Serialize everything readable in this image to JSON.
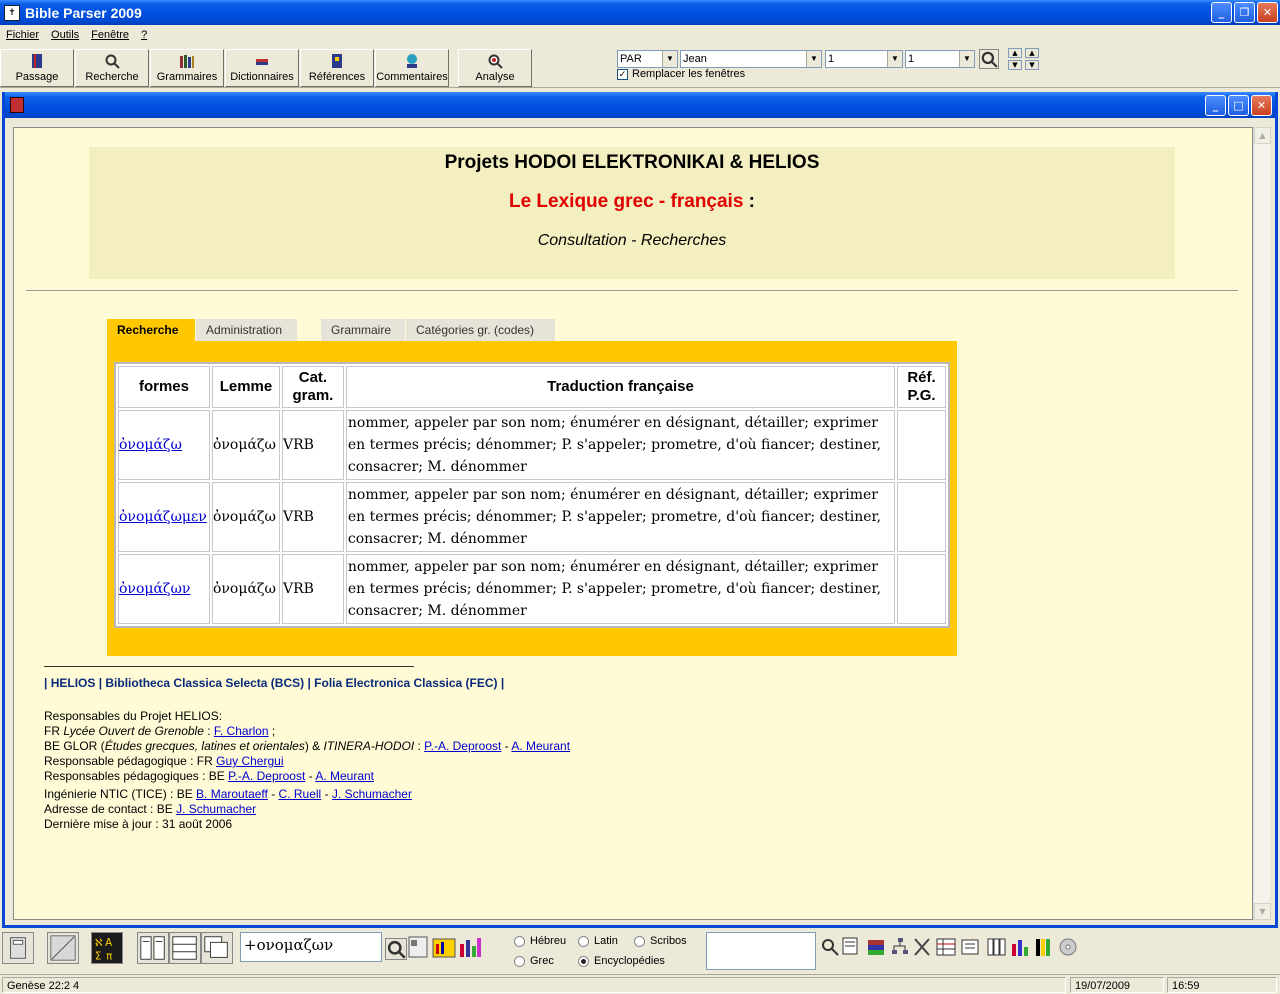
{
  "window": {
    "title": "Bible Parser 2009"
  },
  "menu": [
    "Fichier",
    "Outils",
    "Fenêtre",
    "?"
  ],
  "toolbar": {
    "buttons": [
      "Passage",
      "Recherche",
      "Grammaires",
      "Dictionnaires",
      "Références",
      "Commentaires",
      "Analyse"
    ],
    "version": "PAR",
    "book": "Jean",
    "chapter": "1",
    "verse": "1",
    "replace_windows_label": "Remplacer les fenêtres",
    "replace_windows_checked": true
  },
  "page": {
    "title": "Projets HODOI ELEKTRONIKAI & HELIOS",
    "subtitle_red": "Le Lexique grec - français",
    "subtitle_tail": " :",
    "consultation": "Consultation - Recherches",
    "tabs": [
      "Recherche",
      "Administration",
      "Grammaire",
      "Catégories gr. (codes)"
    ],
    "active_tab": "Recherche",
    "table": {
      "headers": {
        "formes": "formes",
        "lemme": "Lemme",
        "cat": "Cat.\ngram.",
        "trad": "Traduction française",
        "ref": "Réf.\nP.G."
      },
      "rows": [
        {
          "forme": "ὀνομάζω",
          "lemme": "ὀνομάζω",
          "cat": "VRB",
          "trad": "nommer, appeler par son nom; énumérer en désignant, détailler; exprimer en termes précis; dénommer; P. s'appeler; prometre, d'où fiancer; destiner, consacrer; M. dénommer",
          "ref": ""
        },
        {
          "forme": "ὀνομάζωμεν",
          "lemme": "ὀνομάζω",
          "cat": "VRB",
          "trad": "nommer, appeler par son nom; énumérer en désignant, détailler; exprimer en termes précis; dénommer; P. s'appeler; prometre, d'où fiancer; destiner, consacrer; M. dénommer",
          "ref": ""
        },
        {
          "forme": "ὀνομάζων",
          "lemme": "ὀνομάζω",
          "cat": "VRB",
          "trad": "nommer, appeler par son nom; énumérer en désignant, détailler; exprimer en termes précis; dénommer; P. s'appeler; prometre, d'où fiancer; destiner, consacrer; M. dénommer",
          "ref": ""
        }
      ]
    },
    "footer": {
      "links_line": "| HELIOS | Bibliotheca Classica Selecta (BCS) | Folia Electronica Classica (FEC) |",
      "resp_title": "Responsables du Projet HELIOS:",
      "fr_prefix": "FR ",
      "fr_italic": "Lycée Ouvert de Grenoble",
      "fr_sep": " : ",
      "fr_link": "F. Charlon",
      "fr_tail": " ;",
      "be_prefix": "BE GLOR (",
      "be_italic": "Études grecques, latines et orientales",
      "be_mid": ") & ",
      "be_italic2": "ITINERA-HODOI",
      "be_sep": " : ",
      "be_link1": "P.-A. Deproost",
      "be_dash": " - ",
      "be_link2": "A. Meurant",
      "ped_prefix": "Responsable pédagogique : FR ",
      "ped_link": "Guy Chergui",
      "peds_prefix": "Responsables pédagogiques : BE ",
      "peds_link1": "P.-A. Deproost",
      "peds_dash": " - ",
      "peds_link2": "A. Meurant",
      "ntic_prefix": "Ingénierie NTIC (TICE) : BE ",
      "ntic_link1": "B. Maroutaeff",
      "ntic_dash1": " - ",
      "ntic_link2": "C. Ruell",
      "ntic_dash2": " - ",
      "ntic_link3": "J. Schumacher",
      "contact_prefix": "Adresse de contact : BE ",
      "contact_link": "J. Schumacher",
      "updated": "Dernière mise à jour : 31 août 2006"
    }
  },
  "bottom": {
    "search_value": "+ονομαζων",
    "languages": [
      {
        "label": "Hébreu",
        "selected": false
      },
      {
        "label": "Latin",
        "selected": false
      },
      {
        "label": "Scribos",
        "selected": false
      },
      {
        "label": "Grec",
        "selected": false
      },
      {
        "label": "Encyclopédies",
        "selected": true
      }
    ]
  },
  "status": {
    "reference": "Genèse 22:2  4",
    "date": "19/07/2009",
    "time": "16:59"
  }
}
